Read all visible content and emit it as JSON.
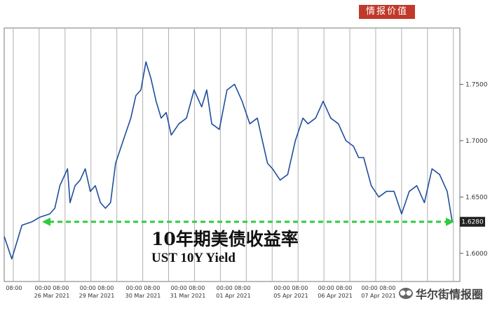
{
  "badge": "情报价值",
  "title_cn": "10年期美债收益率",
  "title_en": "UST 10Y Yield",
  "watermark": "华尔街情报圈",
  "watermark_icon": "wechat-icon",
  "colors": {
    "line": "#1f4e9c",
    "dashed": "#2ecc40",
    "grid": "#b0b0b0",
    "badge": "#c0392b",
    "last_tag": "#222222"
  },
  "chart_data": {
    "type": "line",
    "title": "10年期美债收益率",
    "subtitle": "UST 10Y Yield",
    "ylim": [
      1.575,
      1.8
    ],
    "yticks": [
      1.6,
      1.65,
      1.7,
      1.75
    ],
    "ytick_labels": [
      "1.6000",
      "1.6500",
      "1.7000",
      "1.7500"
    ],
    "last_value": 1.628,
    "last_label": "1.6280",
    "reference_level": 1.628,
    "grid": true,
    "x_labels": [
      {
        "time": "08:00",
        "date": ""
      },
      {
        "time": "00:00 08:00",
        "date": "26 Mar 2021"
      },
      {
        "time": "00:00 08:00",
        "date": "29 Mar 2021"
      },
      {
        "time": "00:00 08:00",
        "date": "30 Mar 2021"
      },
      {
        "time": "00:00 08:00",
        "date": "31 Mar 2021"
      },
      {
        "time": "00:00 08:00",
        "date": "01 Apr 2021"
      },
      {
        "time": "00:00 08:00",
        "date": "05 Apr 2021"
      },
      {
        "time": "00:00 08:00",
        "date": "06 Apr 2021"
      },
      {
        "time": "00:00 08:00",
        "date": "07 Apr 2021"
      }
    ],
    "series": [
      {
        "x": [
          0,
          0.15,
          0.35,
          0.55,
          0.7,
          0.9,
          1.0,
          1.1,
          1.25,
          1.3,
          1.4,
          1.5,
          1.6,
          1.7,
          1.8,
          1.9,
          2.0,
          2.1,
          2.2,
          2.35,
          2.5,
          2.6,
          2.7,
          2.8,
          2.9,
          3.0,
          3.1,
          3.2,
          3.3,
          3.45,
          3.6,
          3.75,
          3.9,
          4.0,
          4.1,
          4.25,
          4.4,
          4.55,
          4.7,
          4.85,
          5.0,
          5.1,
          5.2,
          5.3,
          5.45,
          5.6,
          5.75,
          5.9,
          6.0,
          6.15,
          6.3,
          6.45,
          6.6,
          6.75,
          6.9,
          7.0,
          7.1,
          7.25,
          7.4,
          7.55,
          7.7,
          7.85,
          8.0,
          8.15,
          8.3,
          8.45,
          8.6,
          8.75,
          8.85
        ],
        "values": [
          1.615,
          1.595,
          1.625,
          1.628,
          1.632,
          1.635,
          1.64,
          1.66,
          1.675,
          1.645,
          1.66,
          1.665,
          1.675,
          1.655,
          1.66,
          1.645,
          1.64,
          1.645,
          1.68,
          1.7,
          1.72,
          1.74,
          1.745,
          1.77,
          1.755,
          1.735,
          1.72,
          1.725,
          1.705,
          1.715,
          1.72,
          1.745,
          1.73,
          1.745,
          1.715,
          1.71,
          1.745,
          1.75,
          1.735,
          1.715,
          1.72,
          1.7,
          1.68,
          1.675,
          1.665,
          1.67,
          1.7,
          1.72,
          1.715,
          1.72,
          1.735,
          1.72,
          1.715,
          1.7,
          1.695,
          1.685,
          1.685,
          1.66,
          1.65,
          1.655,
          1.655,
          1.635,
          1.655,
          1.66,
          1.645,
          1.675,
          1.67,
          1.655,
          1.628
        ]
      }
    ]
  }
}
